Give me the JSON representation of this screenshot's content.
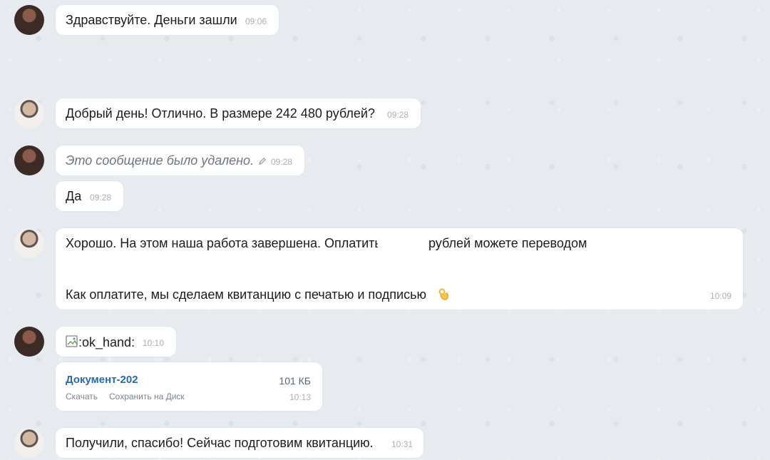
{
  "messages": [
    {
      "text": "Здравствуйте. Деньги зашли",
      "time": "09:06"
    },
    {
      "text": "Добрый день! Отлично. В размере 242 480 рублей?",
      "time": "09:28"
    },
    {
      "text": "Это сообщение было удалено.",
      "time": "09:28"
    },
    {
      "text": "Да",
      "time": "09:28"
    },
    {
      "line1_part1": "Хорошо. На этом наша работа завершена. Оплатить",
      "line1_part2": "рублей можете переводом",
      "line3": "Как оплатите, мы сделаем квитанцию с печатью и подписью",
      "time": "10:09"
    },
    {
      "text": ":ok_hand:",
      "time": "10:10"
    },
    {
      "file_name": "Документ-202",
      "size": "101 КБ",
      "download": "Скачать",
      "save_to_disk": "Сохранить на Диск",
      "time": "10:13"
    },
    {
      "text": "Получили, спасибо! Сейчас подготовим квитанцию.",
      "time": "10:31"
    }
  ],
  "icons": {
    "avatar_dark": "avatar-dark",
    "avatar_light": "avatar-light",
    "edit": "pencil-icon",
    "ok_hand": "ok-hand-icon",
    "broken_image": "broken-image-icon"
  }
}
